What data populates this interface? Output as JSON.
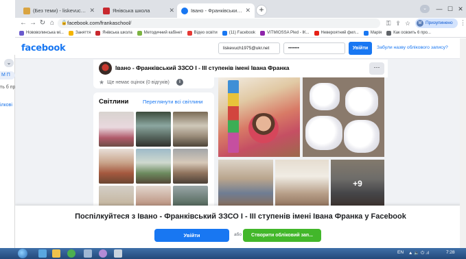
{
  "other_window": {
    "chevron": "⌄",
    "button_text": "M П",
    "line1": "ть б про",
    "line2": "ілкові"
  },
  "browser": {
    "tabs": [
      {
        "title": "(Без теми) - liskevuch1975@ukr…",
        "favicon_color": "#d9a441",
        "close": "✕"
      },
      {
        "title": "Янівська школа",
        "favicon_color": "#c8282e",
        "close": "✕"
      },
      {
        "title": "Івано - Франківський ЗЗСО І - ІІ",
        "favicon_color": "#1877f2",
        "close": "✕"
      }
    ],
    "new_tab": "+",
    "url": "facebook.com/frankaschool/",
    "profile_label": "Призупинено",
    "profile_initial": "M",
    "bookmarks": [
      {
        "label": "Нововолинська мі...",
        "color": "#6a5acd"
      },
      {
        "label": "Заняття",
        "color": "#f4b400"
      },
      {
        "label": "Янівська школа",
        "color": "#c8282e"
      },
      {
        "label": "Методичний кабінет",
        "color": "#7cb342"
      },
      {
        "label": "Відео освіти",
        "color": "#e53935"
      },
      {
        "label": "(11) Facebook",
        "color": "#1877f2"
      },
      {
        "label": "VITMIOSSA Plеd - ІК...",
        "color": "#8e24aa"
      },
      {
        "label": "Невероятний фил...",
        "color": "#e62117"
      },
      {
        "label": "Марія",
        "color": "#1877f2"
      },
      {
        "label": "Как освоить 6 про...",
        "color": "#5f6368"
      }
    ]
  },
  "facebook": {
    "logo": "facebook",
    "email_value": "liskevuch1975@ukr.net",
    "password_value": "•••••••",
    "login_button": "Увійти",
    "forgot_link": "Забули назву облікового запису?",
    "page_name": "Івано - Франківський ЗЗСО І - ІІІ ступенів імені Івана Франка",
    "more_button": "···",
    "rating_text": "Ще немає оцінок (0 відгуків)",
    "info_icon": "i",
    "photos_title": "Світлини",
    "photos_link": "Переглянути всі світлини",
    "more_photos_count": "+9",
    "bottom_title": "Поспілкуйтеся з Івано - Франківський ЗЗСО І - ІІІ ступенів імені Івана Франка у Facebook",
    "bottom_login": "Увійти",
    "bottom_or": "або",
    "bottom_create": "Створити обліковий зап..."
  },
  "taskbar": {
    "language": "EN",
    "tray": "▲ 🔈 ⏻ .ıl",
    "time": "7:28"
  }
}
